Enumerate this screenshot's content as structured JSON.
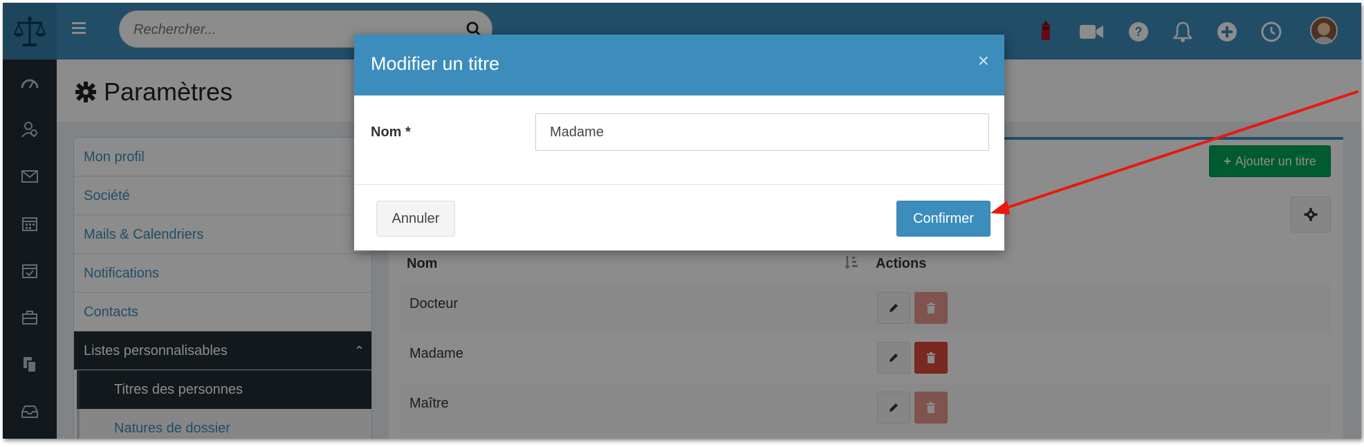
{
  "app": {
    "search_placeholder": "Rechercher..."
  },
  "page": {
    "title": "Paramètres"
  },
  "sidebar": {
    "items": [
      {
        "label": "Mon profil"
      },
      {
        "label": "Société"
      },
      {
        "label": "Mails & Calendriers"
      },
      {
        "label": "Notifications"
      },
      {
        "label": "Contacts"
      },
      {
        "label": "Listes personnalisables"
      }
    ],
    "subitems": [
      {
        "label": "Titres des personnes"
      },
      {
        "label": "Natures de dossier"
      }
    ]
  },
  "toolbar": {
    "add_label": "Ajouter un titre"
  },
  "table": {
    "headers": {
      "name": "Nom",
      "actions": "Actions"
    },
    "rows": [
      {
        "name": "Docteur"
      },
      {
        "name": "Madame"
      },
      {
        "name": "Maître"
      }
    ]
  },
  "modal": {
    "title": "Modifier un titre",
    "close_glyph": "×",
    "field_label": "Nom *",
    "field_value": "Madame",
    "cancel_label": "Annuler",
    "confirm_label": "Confirmer"
  },
  "colors": {
    "primary": "#3c8dbc",
    "success": "#00a65a",
    "danger": "#dd4b39",
    "sidebar": "#222d32",
    "annotation_arrow": "#e8190f"
  }
}
